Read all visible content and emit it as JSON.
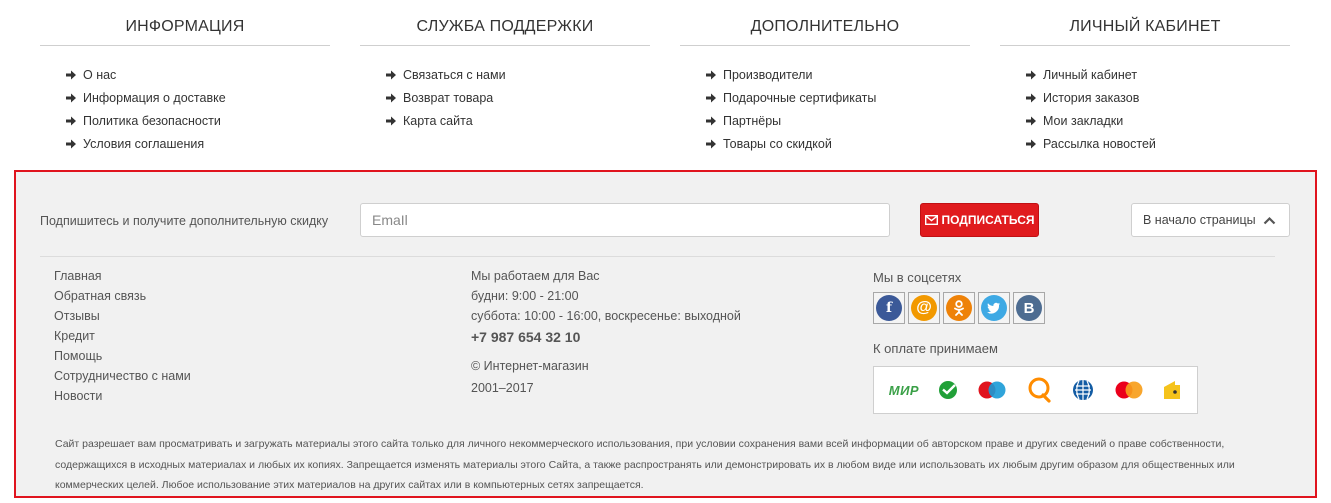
{
  "columns": [
    {
      "title": "ИНФОРМАЦИЯ",
      "items": [
        "О нас",
        "Информация о доставке",
        "Политика безопасности",
        "Условия соглашения"
      ]
    },
    {
      "title": "СЛУЖБА ПОДДЕРЖКИ",
      "items": [
        "Связаться с нами",
        "Возврат товара",
        "Карта сайта"
      ]
    },
    {
      "title": "ДОПОЛНИТЕЛЬНО",
      "items": [
        "Производители",
        "Подарочные сертификаты",
        "Партнёры",
        "Товары со скидкой"
      ]
    },
    {
      "title": "ЛИЧНЫЙ КАБИНЕТ",
      "items": [
        "Личный кабинет",
        "История заказов",
        "Мои закладки",
        "Рассылка новостей"
      ]
    }
  ],
  "newsletter": {
    "label": "Подпишитесь и получите дополнительную скидку",
    "placeholder": "EmaIl",
    "button_label": "ПОДПИСАТЬСЯ",
    "button_icon": "envelope-icon"
  },
  "back_to_top": {
    "label": "В начало страницы",
    "icon": "chevron-up-icon"
  },
  "footer_links": [
    "Главная",
    "Обратная связь",
    "Отзывы",
    "Кредит",
    "Помощь",
    "Сотрудничество с нами",
    "Новости"
  ],
  "contacts": {
    "title": "Мы работаем для Вас",
    "weekdays": "будни: 9:00 - 21:00",
    "weekend": "суббота: 10:00 - 16:00, воскресенье: выходной",
    "phone": "+7 987 654 32 10",
    "copyright": "© Интернет-магазин",
    "years": "2001–2017"
  },
  "social": {
    "title": "Мы в соцсетях",
    "items": [
      {
        "icon": "facebook-icon",
        "glyph": "f",
        "color": "#3b5998"
      },
      {
        "icon": "mail-ru-icon",
        "glyph": "@",
        "color": "#f29900"
      },
      {
        "icon": "odnoklassniki-icon",
        "glyph": "ok",
        "color": "#ee8208"
      },
      {
        "icon": "twitter-icon",
        "glyph": "tw",
        "color": "#3ea9e4"
      },
      {
        "icon": "vk-icon",
        "glyph": "В",
        "color": "#4d6c91"
      }
    ]
  },
  "payment": {
    "title": "К оплате принимаем",
    "items": [
      "mir-icon",
      "sberbank-icon",
      "maestro-icon",
      "qiwi-icon",
      "webmoney-icon",
      "mastercard-icon",
      "yandex-money-icon"
    ],
    "mir_label": "МИР"
  },
  "legal": "Сайт разрешает вам просматривать и загружать материалы этого сайта только для личного некоммерческого использования, при условии сохранения вами всей информации об авторском праве и других сведений о праве собственности, содержащихся в исходных материалах и любых их копиях. Запрещается изменять материалы этого Сайта, а также распространять или демонстрировать их в любом виде или использовать их любым другим образом для общественных или коммерческих целей. Любое использование этих материалов на других сайтах или в компьютерных сетях запрещается.",
  "colors": {
    "accent": "#e01b1e",
    "panel_border": "#e0141e",
    "panel_bg": "#f1f1f1"
  }
}
